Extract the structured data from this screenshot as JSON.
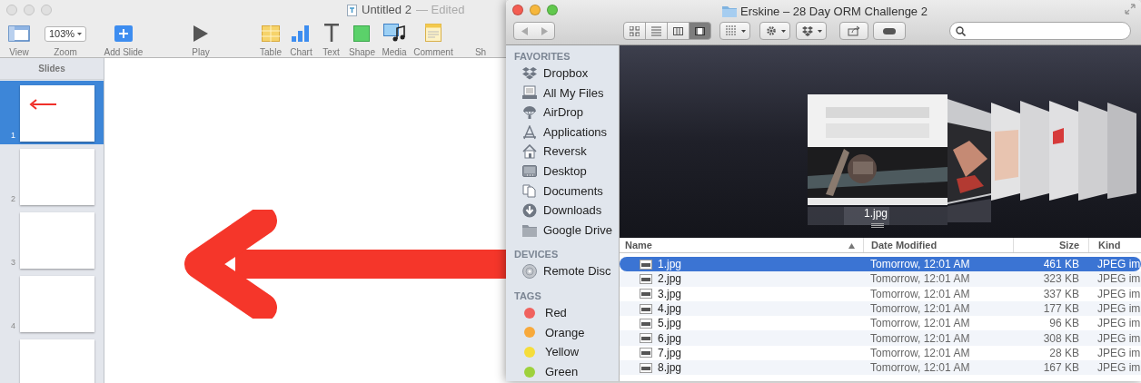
{
  "keynote": {
    "title": "Untitled 2",
    "edited": "— Edited",
    "toolbar": [
      {
        "kind": "view",
        "label": "View"
      },
      {
        "kind": "zoom",
        "label": "Zoom",
        "value": "103%"
      },
      {
        "kind": "add",
        "label": "Add Slide"
      },
      {
        "kind": "play",
        "label": "Play"
      },
      {
        "kind": "table",
        "label": "Table"
      },
      {
        "kind": "chart",
        "label": "Chart"
      },
      {
        "kind": "text",
        "label": "Text"
      },
      {
        "kind": "shape",
        "label": "Shape"
      },
      {
        "kind": "media",
        "label": "Media"
      },
      {
        "kind": "comment",
        "label": "Comment"
      },
      {
        "kind": "cut",
        "label": "Sh"
      }
    ],
    "slides_header": "Slides",
    "slides": [
      {
        "number": "1",
        "selected": true,
        "kind": "arrow"
      },
      {
        "number": "2",
        "selected": false
      },
      {
        "number": "3",
        "selected": false
      },
      {
        "number": "4",
        "selected": false
      },
      {
        "selected": false
      }
    ]
  },
  "finder": {
    "title": "Erskine – 28 Day ORM Challenge 2",
    "view_modes": [
      {
        "kind": "icons",
        "selected": false
      },
      {
        "kind": "list",
        "selected": false
      },
      {
        "kind": "columns",
        "selected": false
      },
      {
        "kind": "coverflow",
        "selected": true
      }
    ],
    "sidebar": [
      {
        "heading": "FAVORITES",
        "items": [
          {
            "label": "Dropbox",
            "kind": "dropbox"
          },
          {
            "label": "All My Files",
            "kind": "files"
          },
          {
            "label": "AirDrop",
            "kind": "airdrop"
          },
          {
            "label": "Applications",
            "kind": "apps"
          },
          {
            "label": "Reversk",
            "kind": "home"
          },
          {
            "label": "Desktop",
            "kind": "desktop"
          },
          {
            "label": "Documents",
            "kind": "documents"
          },
          {
            "label": "Downloads",
            "kind": "downloads"
          },
          {
            "label": "Google Drive",
            "kind": "folder"
          }
        ]
      },
      {
        "heading": "DEVICES",
        "items": [
          {
            "label": "Remote Disc",
            "kind": "disc"
          }
        ]
      },
      {
        "heading": "TAGS",
        "items": [
          {
            "label": "Red",
            "kind": "tag",
            "color": "#f0625e"
          },
          {
            "label": "Orange",
            "kind": "tag",
            "color": "#f7a93b"
          },
          {
            "label": "Yellow",
            "kind": "tag",
            "color": "#f5dd3b"
          },
          {
            "label": "Green",
            "kind": "tag",
            "color": "#9ed13c"
          }
        ]
      }
    ],
    "coverflow": {
      "caption": "1.jpg"
    },
    "columns": [
      "Name",
      "Date Modified",
      "Size",
      "Kind"
    ],
    "rows": [
      {
        "name": "1.jpg",
        "date": "Tomorrow, 12:01 AM",
        "size": "461 KB",
        "kind": "JPEG im",
        "selected": true
      },
      {
        "name": "2.jpg",
        "date": "Tomorrow, 12:01 AM",
        "size": "323 KB",
        "kind": "JPEG im",
        "selected": false
      },
      {
        "name": "3.jpg",
        "date": "Tomorrow, 12:01 AM",
        "size": "337 KB",
        "kind": "JPEG im",
        "selected": false
      },
      {
        "name": "4.jpg",
        "date": "Tomorrow, 12:01 AM",
        "size": "177 KB",
        "kind": "JPEG im",
        "selected": false
      },
      {
        "name": "5.jpg",
        "date": "Tomorrow, 12:01 AM",
        "size": "96 KB",
        "kind": "JPEG im",
        "selected": false
      },
      {
        "name": "6.jpg",
        "date": "Tomorrow, 12:01 AM",
        "size": "308 KB",
        "kind": "JPEG im",
        "selected": false
      },
      {
        "name": "7.jpg",
        "date": "Tomorrow, 12:01 AM",
        "size": "28 KB",
        "kind": "JPEG im",
        "selected": false
      },
      {
        "name": "8.jpg",
        "date": "Tomorrow, 12:01 AM",
        "size": "167 KB",
        "kind": "JPEG im",
        "selected": false
      }
    ]
  }
}
